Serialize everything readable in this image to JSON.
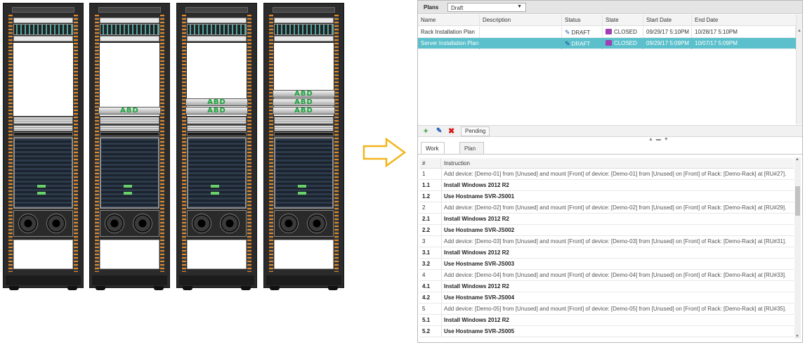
{
  "plans_panel": {
    "title": "Plans",
    "filter_value": "Draft",
    "columns": [
      "Name",
      "Description",
      "Status",
      "State",
      "Start Date",
      "End Date"
    ],
    "rows": [
      {
        "name": "Rack Installation Plan",
        "description": "",
        "status": "DRAFT",
        "state": "CLOSED",
        "start": "09/29/17 5:10PM",
        "end": "10/28/17 5:10PM",
        "selected": false
      },
      {
        "name": "Server Installation Plan",
        "description": "",
        "status": "DRAFT",
        "state": "CLOSED",
        "start": "09/29/17 5:09PM",
        "end": "10/07/17 5:09PM",
        "selected": true
      }
    ]
  },
  "toolbar": {
    "add_icon": "+",
    "edit_icon": "✎",
    "delete_icon": "✖",
    "pending_label": "Pending"
  },
  "tabs": {
    "work_order": "Work Order",
    "plan_notes": "Plan Notes"
  },
  "work_order": {
    "columns": [
      "#",
      "Instruction"
    ],
    "rows": [
      {
        "num": "1",
        "text": "Add device: [Demo-01] from [Unused] and mount [Front] of device: [Demo-01] from [Unused] on [Front] of Rack: [Demo-Rack] at [RU#27].",
        "sub": false
      },
      {
        "num": "1.1",
        "text": "Install Windows 2012 R2",
        "sub": true
      },
      {
        "num": "1.2",
        "text": "Use Hostname SVR-JS001",
        "sub": true
      },
      {
        "num": "2",
        "text": "Add device: [Demo-02] from [Unused] and mount [Front] of device: [Demo-02] from [Unused] on [Front] of Rack: [Demo-Rack] at [RU#29].",
        "sub": false
      },
      {
        "num": "2.1",
        "text": "Install Windows 2012 R2",
        "sub": true
      },
      {
        "num": "2.2",
        "text": "Use Hostname SVR-JS002",
        "sub": true
      },
      {
        "num": "3",
        "text": "Add device: [Demo-03] from [Unused] and mount [Front] of device: [Demo-03] from [Unused] on [Front] of Rack: [Demo-Rack] at [RU#31].",
        "sub": false
      },
      {
        "num": "3.1",
        "text": "Install Windows 2012 R2",
        "sub": true
      },
      {
        "num": "3.2",
        "text": "Use Hostname SVR-JS003",
        "sub": true
      },
      {
        "num": "4",
        "text": "Add device: [Demo-04] from [Unused] and mount [Front] of device: [Demo-04] from [Unused] on [Front] of Rack: [Demo-Rack] at [RU#33].",
        "sub": false
      },
      {
        "num": "4.1",
        "text": "Install Windows 2012 R2",
        "sub": true
      },
      {
        "num": "4.2",
        "text": "Use Hostname SVR-JS004",
        "sub": true
      },
      {
        "num": "5",
        "text": "Add device: [Demo-05] from [Unused] and mount [Front] of device: [Demo-05] from [Unused] on [Front] of Rack: [Demo-Rack] at [RU#35].",
        "sub": false
      },
      {
        "num": "5.1",
        "text": "Install Windows 2012 R2",
        "sub": true
      },
      {
        "num": "5.2",
        "text": "Use Hostname SVR-JS005",
        "sub": true
      }
    ]
  },
  "racks": {
    "server_label": "ABD",
    "server_counts": [
      0,
      1,
      2,
      3
    ]
  },
  "colors": {
    "selection": "#5bc0cc",
    "arrow": "#f2b51e",
    "server_label": "#1aa33a"
  }
}
